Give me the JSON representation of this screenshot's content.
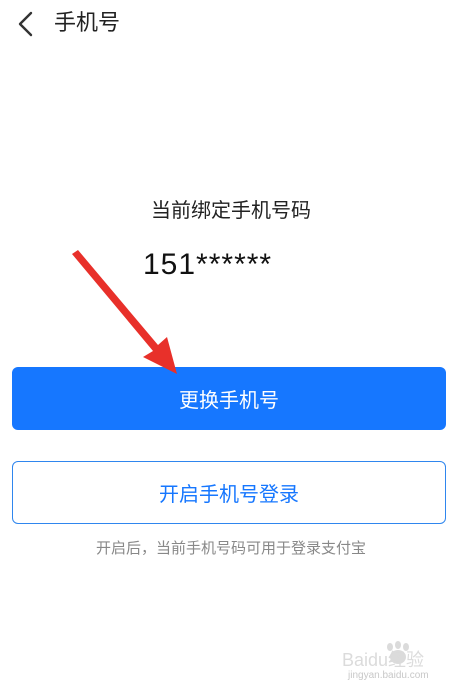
{
  "header": {
    "back_icon": "chevron-left-icon",
    "title": "手机号"
  },
  "main": {
    "bound_label": "当前绑定手机号码",
    "phone_number": "151******",
    "change_button_label": "更换手机号",
    "enable_login_button_label": "开启手机号登录",
    "hint": "开启后，当前手机号码可用于登录支付宝"
  },
  "annotation": {
    "icon": "red-arrow-icon",
    "color": "#e8302a"
  },
  "watermark": {
    "logo": "Baidu经验",
    "url": "jingyan.baidu.com"
  },
  "colors": {
    "primary": "#1677ff",
    "outline": "#2f86ee",
    "hint": "#888888"
  }
}
